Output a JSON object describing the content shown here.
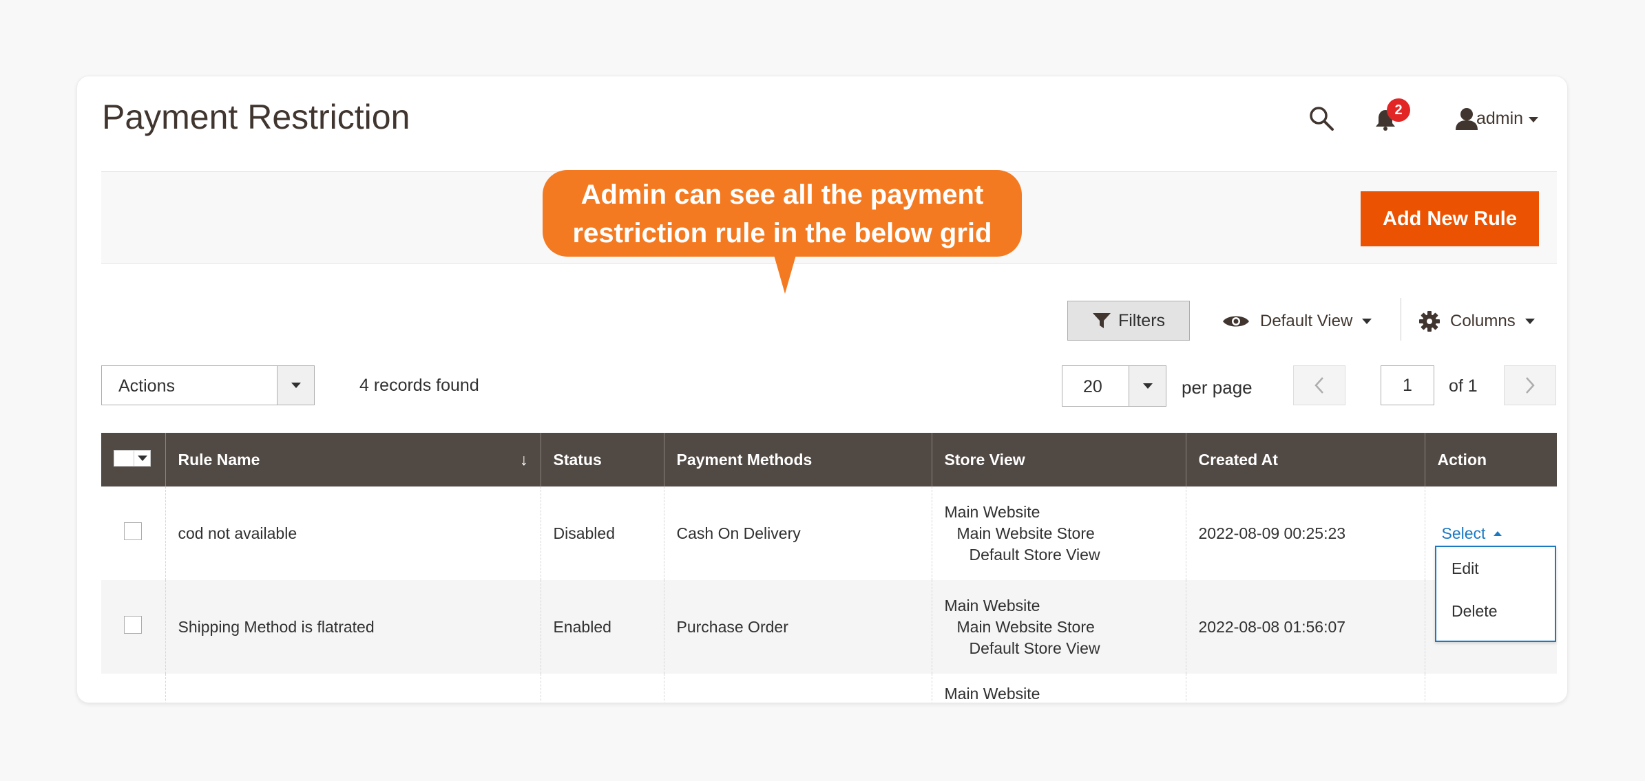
{
  "header": {
    "title": "Payment Restriction",
    "notification_count": "2",
    "user_name": "admin",
    "icons": [
      "search-icon",
      "bell-icon",
      "user-icon"
    ]
  },
  "actions_bar": {
    "add_button_label": "Add New Rule"
  },
  "callout": {
    "line1": "Admin can see all the payment",
    "line2": "restriction rule in the below grid"
  },
  "toolbar": {
    "filters_label": "Filters",
    "view_label": "Default View",
    "columns_label": "Columns"
  },
  "paging": {
    "actions_label": "Actions",
    "records_found": "4 records found",
    "per_page_value": "20",
    "per_page_label": "per page",
    "current_page": "1",
    "total_pages_label": "of 1"
  },
  "grid": {
    "columns": [
      "Rule Name",
      "Status",
      "Payment Methods",
      "Store View",
      "Created At",
      "Action"
    ],
    "sort_indicator": "↓",
    "rows": [
      {
        "rule_name": "cod not available",
        "status": "Disabled",
        "payment_methods": "Cash On Delivery",
        "store_view": [
          "Main Website",
          "Main Website Store",
          "Default Store View"
        ],
        "created_at": "2022-08-09 00:25:23",
        "action": "Select"
      },
      {
        "rule_name": "Shipping Method is flatrated",
        "status": "Enabled",
        "payment_methods": "Purchase Order",
        "store_view": [
          "Main Website",
          "Main Website Store",
          "Default Store View"
        ],
        "created_at": "2022-08-08 01:56:07",
        "action": ""
      },
      {
        "rule_name": "",
        "status": "",
        "payment_methods": "",
        "store_view": [
          "Main Website"
        ],
        "created_at": "",
        "action": ""
      }
    ],
    "action_menu": [
      "Edit",
      "Delete"
    ]
  },
  "colors": {
    "accent": "#eb5202",
    "callout": "#f47a22",
    "grid_header": "#514943",
    "link": "#1979c3",
    "badge": "#e22626"
  }
}
